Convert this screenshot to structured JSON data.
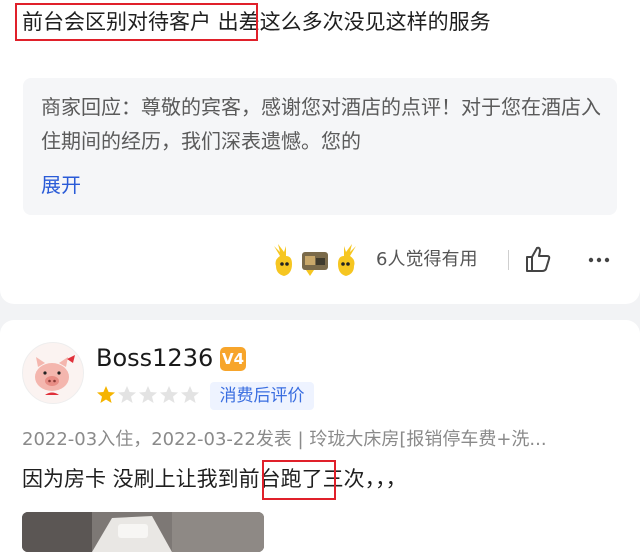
{
  "review1": {
    "text": "前台会区别对待客户 出差这么多次没见这样的服务",
    "reply_text": "商家回应：尊敬的宾客，感谢您对酒店的点评！对于您在酒店入住期间的经历，我们深表遗憾。您的",
    "expand_label": "展开",
    "helpful_text": "6人觉得有用"
  },
  "review2": {
    "username": "Boss1236",
    "level_badge": "V4",
    "rating_stars": 1,
    "rating_max": 5,
    "tag": "消费后评价",
    "meta": "2022-03入住，2022-03-22发表 | 玲珑大床房[报销停车费+洗...",
    "text": "因为房卡 没刷上让我到前台跑了三次，，，"
  },
  "colors": {
    "highlight_box": "#e0202a",
    "link": "#2a5bd7",
    "star_filled": "#f5b400",
    "star_empty": "#e3e3e3",
    "tag_text": "#3a6ee0",
    "badge": "#f7a52b"
  },
  "icons": [
    "yellow-reaction-icon",
    "photo-reaction-icon",
    "thumbs-up-icon",
    "more-dots-icon",
    "pig-avatar",
    "level-badge-icon"
  ]
}
